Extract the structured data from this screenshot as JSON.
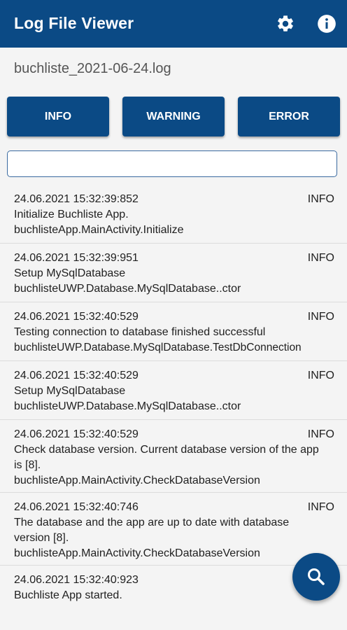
{
  "appbar": {
    "title": "Log File Viewer",
    "settings_icon": "gear-icon",
    "info_icon": "info-icon"
  },
  "file": {
    "name": "buchliste_2021-06-24.log"
  },
  "filters": {
    "info": "INFO",
    "warning": "WARNING",
    "error": "ERROR"
  },
  "search": {
    "value": ""
  },
  "entries": [
    {
      "timestamp": "24.06.2021 15:32:39:852",
      "level": "INFO",
      "message": "Initialize Buchliste App.",
      "source": "buchlisteApp.MainActivity.Initialize"
    },
    {
      "timestamp": "24.06.2021 15:32:39:951",
      "level": "INFO",
      "message": "Setup MySqlDatabase",
      "source": "buchlisteUWP.Database.MySqlDatabase..ctor"
    },
    {
      "timestamp": "24.06.2021 15:32:40:529",
      "level": "INFO",
      "message": "Testing connection to database finished successful",
      "source": "buchlisteUWP.Database.MySqlDatabase.TestDbConnection"
    },
    {
      "timestamp": "24.06.2021 15:32:40:529",
      "level": "INFO",
      "message": "Setup MySqlDatabase",
      "source": "buchlisteUWP.Database.MySqlDatabase..ctor"
    },
    {
      "timestamp": "24.06.2021 15:32:40:529",
      "level": "INFO",
      "message": "Check database version. Current database version of the app is [8].",
      "source": "buchlisteApp.MainActivity.CheckDatabaseVersion"
    },
    {
      "timestamp": "24.06.2021 15:32:40:746",
      "level": "INFO",
      "message": "The database and the app are up to date with database version [8].",
      "source": "buchlisteApp.MainActivity.CheckDatabaseVersion"
    },
    {
      "timestamp": "24.06.2021 15:32:40:923",
      "level": "",
      "message": "Buchliste App started.",
      "source": ""
    }
  ],
  "fab": {
    "icon": "search-icon"
  },
  "colors": {
    "primary": "#0b4a85",
    "background": "#f4f4f4"
  }
}
